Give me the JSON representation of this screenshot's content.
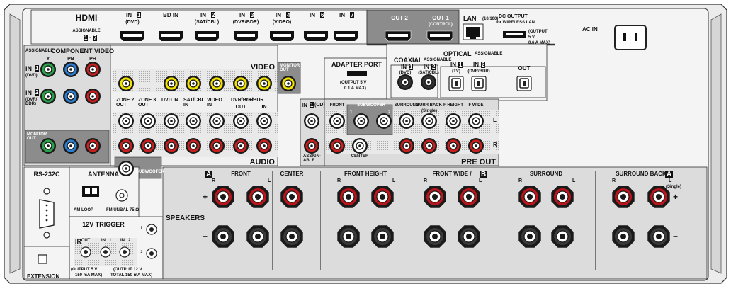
{
  "hdmi": {
    "title": "HDMI",
    "assignable": "ASSIGNABLE",
    "range_a": "1",
    "range_sep": "-",
    "range_b": "7",
    "ports": [
      {
        "in_label": "IN",
        "badge": "1",
        "sub": "(DVD)"
      },
      {
        "in_label": "BD IN",
        "badge": "",
        "sub": ""
      },
      {
        "in_label": "IN",
        "badge": "2",
        "sub": "(SAT/CBL)"
      },
      {
        "in_label": "IN",
        "badge": "3",
        "sub": "(DVR/BDR)"
      },
      {
        "in_label": "IN",
        "badge": "4",
        "sub": "(VIDEO)"
      },
      {
        "in_label": "IN",
        "badge": "6",
        "sub": ""
      },
      {
        "in_label": "IN",
        "badge": "7",
        "sub": ""
      }
    ],
    "out2": "OUT 2",
    "out1": "OUT 1",
    "out1_sub": "(CONTROL)"
  },
  "lan": {
    "label": "LAN",
    "sub": "(10/100)"
  },
  "dc_output": {
    "title": "DC OUTPUT",
    "sub": "for WIRELESS LAN",
    "spec_1": "(OUTPUT",
    "spec_2": "5 V",
    "spec_3": "0.6 A MAX)"
  },
  "ac_in": "AC IN",
  "component_video": {
    "assignable": "ASSIGNABLE",
    "title": "COMPONENT VIDEO",
    "cols": [
      "Y",
      "PB",
      "PR"
    ],
    "in1": {
      "label": "IN",
      "badge": "1",
      "sub": "(DVD)"
    },
    "in2": {
      "label": "IN",
      "badge": "2",
      "sub": "(DVR/ BDR)"
    },
    "monitor_out": "MONITOR OUT"
  },
  "video": {
    "title": "VIDEO",
    "monitor_out": "MONITOR OUT"
  },
  "audio_video_cols": [
    {
      "label": "ZONE 2 OUT"
    },
    {
      "label": "ZONE 3 OUT"
    },
    {
      "label": "DVD IN"
    },
    {
      "label": "SAT/CBL IN"
    },
    {
      "label": "VIDEO IN"
    },
    {
      "label": "DVR/BDR"
    },
    {
      "sub_out": "OUT",
      "sub_in": "IN"
    }
  ],
  "audio_title": "AUDIO",
  "subwoofer_label": "SUBWOOFER",
  "adapter_port": {
    "title": "ADAPTER PORT",
    "spec_1": "(OUTPUT 5 V",
    "spec_2": "0.1 A MAX)"
  },
  "coaxial": {
    "title": "COAXIAL",
    "assignable": "ASSIGNABLE",
    "in1": "IN",
    "in1_badge": "1",
    "in1_sub": "(DVD)",
    "in2": "IN",
    "in2_badge": "2",
    "in2_sub": "(SAT/CBL)"
  },
  "optical": {
    "title": "OPTICAL",
    "assignable": "ASSIGNABLE",
    "in1": "IN",
    "in1_badge": "1",
    "in1_sub": "(TV)",
    "in2": "IN",
    "in2_badge": "2",
    "in2_sub": "(DVR/BDR)",
    "out": "OUT"
  },
  "cd_in": {
    "label": "IN",
    "badge": "1",
    "sub": "(CD)",
    "assignable": "ASSIGN- ABLE"
  },
  "pre_out": {
    "title": "PRE OUT",
    "front": "FRONT",
    "subwoofer": "SUBWOOFER",
    "sw1": "1",
    "sw2": "2",
    "surround": "SURROUND",
    "surr_back": "SURR BACK",
    "single": "(Single)",
    "f_height": "F HEIGHT",
    "f_wide": "F WIDE",
    "center": "CENTER",
    "L": "L",
    "R": "R"
  },
  "rs232c": "RS-232C",
  "antenna": {
    "title": "ANTENNA",
    "am": "AM LOOP",
    "fm": "FM UNBAL 75 Ω"
  },
  "trigger": {
    "title": "12V TRIGGER",
    "n1": "1",
    "n2": "2",
    "ir": "IR",
    "ir_out": "OUT",
    "ir_in1": "IN",
    "ir_in1_n": "1",
    "ir_in2": "IN",
    "ir_in2_n": "2",
    "spec_a_1": "(OUTPUT 5 V",
    "spec_a_2": "150 mA MAX)",
    "spec_b_1": "(OUTPUT 12 V",
    "spec_b_2": "TOTAL 150 mA MAX)"
  },
  "extension": "EXTENSION",
  "speakers": {
    "title": "SPEAKERS",
    "badge_a": "A",
    "badge_b": "B",
    "plus": "+",
    "minus": "−",
    "groups": [
      {
        "label": "FRONT",
        "R": "R",
        "L": "L"
      },
      {
        "label": "CENTER"
      },
      {
        "label": "FRONT HEIGHT",
        "R": "R",
        "L": "L"
      },
      {
        "label": "FRONT WIDE /",
        "R": "R",
        "L": "L"
      },
      {
        "label": "SURROUND",
        "R": "R",
        "L": "L"
      },
      {
        "label": "SURROUND BACK",
        "R": "R",
        "L": "L",
        "single": "(Single)"
      }
    ]
  },
  "colors": {
    "panel": "#dcdcdc",
    "body": "#f2f2f2",
    "dark": "#8c8c8c",
    "jack_red": "#c8201f",
    "jack_yellow": "#f2e200",
    "jack_green": "#2aa24a",
    "jack_blue": "#2d7fd2",
    "jack_white": "#ffffff",
    "post_red": "#b9151b"
  }
}
